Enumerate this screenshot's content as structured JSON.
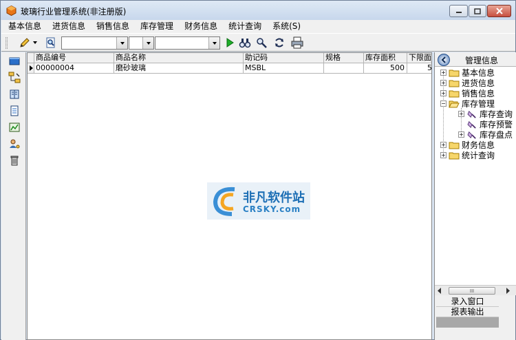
{
  "window": {
    "title": "玻璃行业管理系统(非注册版)"
  },
  "menu": [
    {
      "label": "基本信息"
    },
    {
      "label": "进货信息"
    },
    {
      "label": "销售信息"
    },
    {
      "label": "库存管理"
    },
    {
      "label": "财务信息"
    },
    {
      "label": "统计查询"
    },
    {
      "label": "系统(S)"
    }
  ],
  "grid": {
    "columns": [
      "商品编号",
      "商品名称",
      "助记码",
      "规格",
      "库存面积",
      "下限面"
    ],
    "rows": [
      {
        "code": "00000004",
        "name": "磨砂玻璃",
        "mnemonic": "MSBL",
        "spec": "",
        "area": "500",
        "lower": "5"
      }
    ]
  },
  "watermark": {
    "main": "非凡软件站",
    "sub": "CRSKY.com"
  },
  "panel": {
    "title": "管理信息",
    "tree": [
      {
        "label": "基本信息"
      },
      {
        "label": "进货信息"
      },
      {
        "label": "销售信息"
      },
      {
        "label": "库存管理"
      },
      {
        "label": "库存查询"
      },
      {
        "label": "库存预警"
      },
      {
        "label": "库存盘点"
      },
      {
        "label": "财务信息"
      },
      {
        "label": "统计查询"
      }
    ],
    "scroll_thumb": "III",
    "buttons": [
      "录入窗口",
      "报表输出"
    ]
  }
}
